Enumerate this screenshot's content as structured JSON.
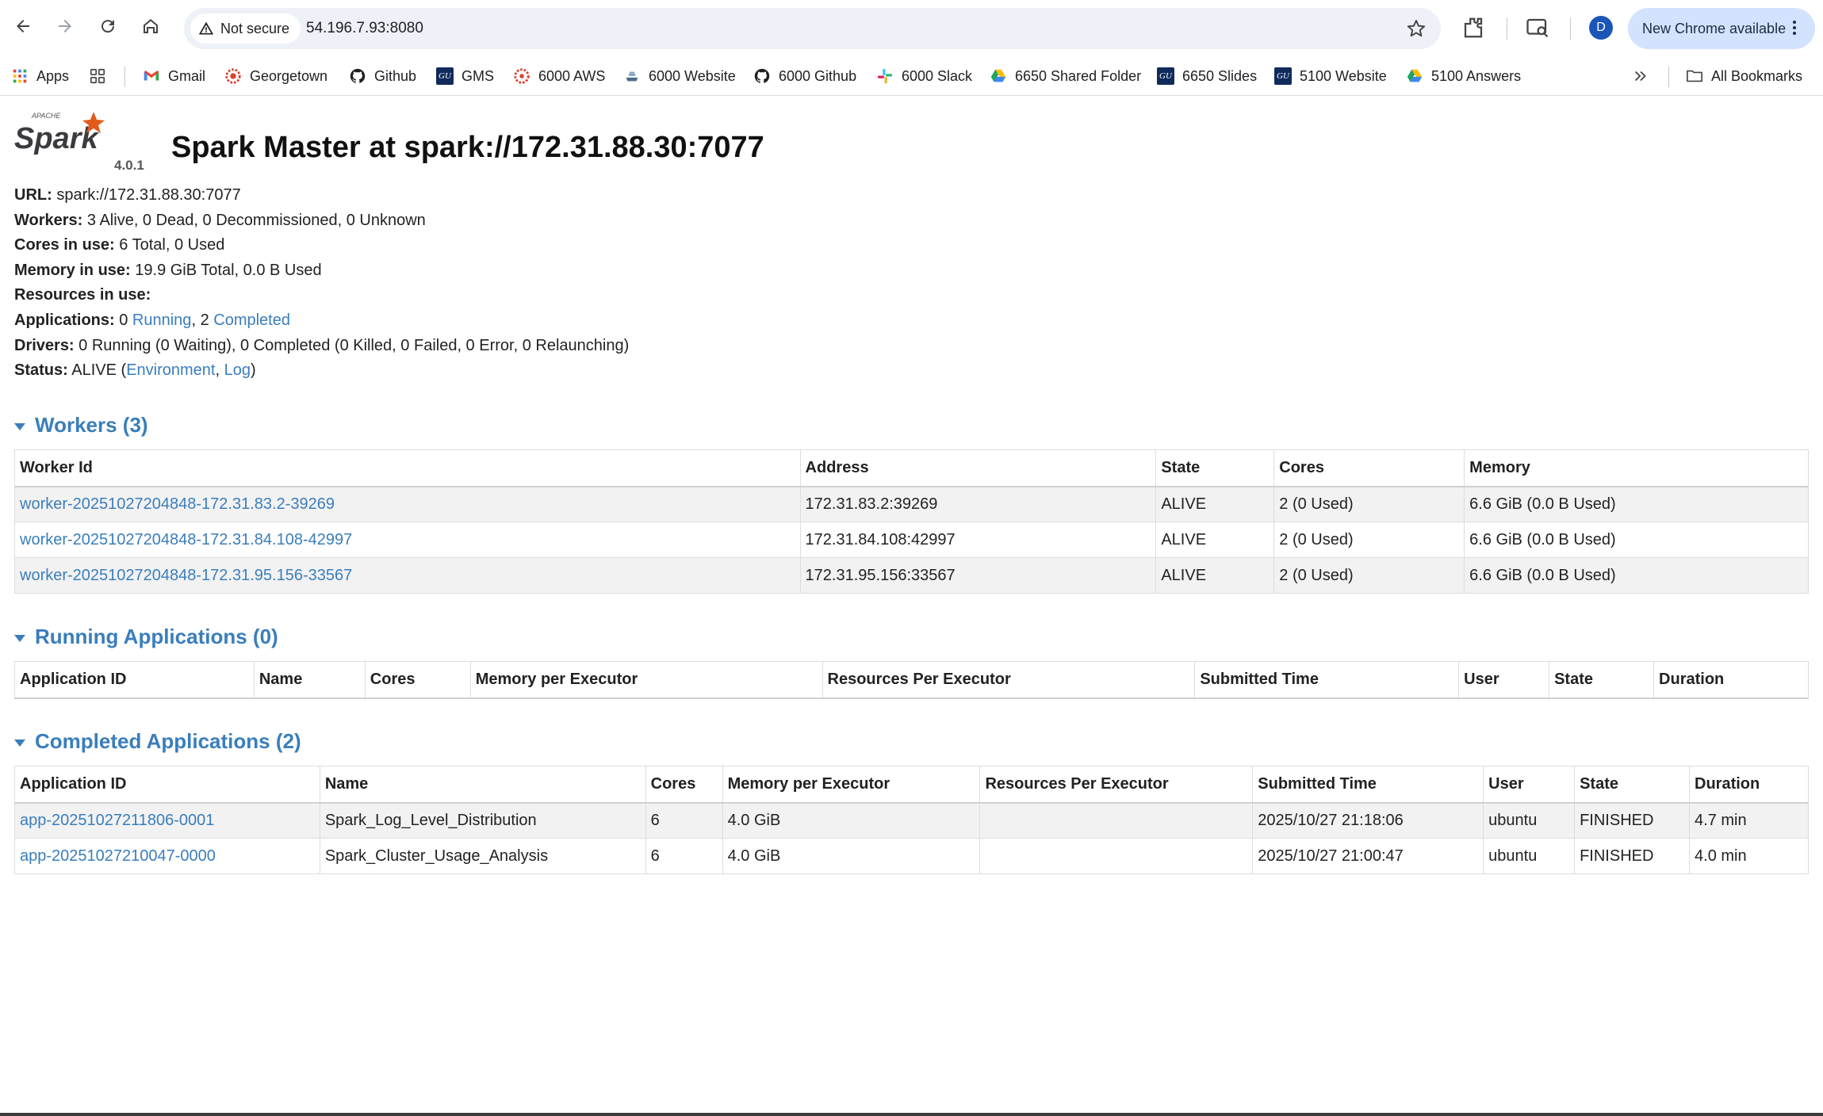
{
  "browser": {
    "security_label": "Not secure",
    "url": "54.196.7.93:8080",
    "update_label": "New Chrome available",
    "profile_initial": "D",
    "bookmarks": [
      {
        "label": "Apps",
        "icon": "apps-grid-icon"
      },
      {
        "label": "Gmail",
        "icon": "gmail-icon"
      },
      {
        "label": "Georgetown",
        "icon": "georgetown-icon"
      },
      {
        "label": "Github",
        "icon": "github-icon"
      },
      {
        "label": "GMS",
        "icon": "gu-icon"
      },
      {
        "label": "6000 AWS",
        "icon": "canvas-icon"
      },
      {
        "label": "6000 Website",
        "icon": "website-icon"
      },
      {
        "label": "6000 Github",
        "icon": "github-icon"
      },
      {
        "label": "6000 Slack",
        "icon": "slack-icon"
      },
      {
        "label": "6650 Shared Folder",
        "icon": "drive-icon"
      },
      {
        "label": "6650 Slides",
        "icon": "gu-icon"
      },
      {
        "label": "5100 Website",
        "icon": "gu-icon"
      },
      {
        "label": "5100 Answers",
        "icon": "drive-icon"
      }
    ],
    "all_bookmarks_label": "All Bookmarks",
    "gu_badge_text": "GU"
  },
  "header": {
    "logo_text": "Spark",
    "logo_small_text": "APACHE",
    "version": "4.0.1",
    "title": "Spark Master at spark://172.31.88.30:7077"
  },
  "summary": {
    "url_label": "URL:",
    "url_value": "spark://172.31.88.30:7077",
    "workers_label": "Workers:",
    "workers_value": "3 Alive, 0 Dead, 0 Decommissioned, 0 Unknown",
    "cores_label": "Cores in use:",
    "cores_value": "6 Total, 0 Used",
    "memory_label": "Memory in use:",
    "memory_value": "19.9 GiB Total, 0.0 B Used",
    "resources_label": "Resources in use:",
    "applications_label": "Applications:",
    "applications_running_count": "0",
    "applications_running_link": "Running",
    "applications_sep": ",",
    "applications_completed_count": "2",
    "applications_completed_link": "Completed",
    "drivers_label": "Drivers:",
    "drivers_value": "0 Running (0 Waiting), 0 Completed (0 Killed, 0 Failed, 0 Error, 0 Relaunching)",
    "status_label": "Status:",
    "status_value": "ALIVE",
    "status_open": "(",
    "status_env_link": "Environment",
    "status_comma": ",",
    "status_log_link": "Log",
    "status_close": ")"
  },
  "workers": {
    "title": "Workers (3)",
    "columns": [
      "Worker Id",
      "Address",
      "State",
      "Cores",
      "Memory"
    ],
    "rows": [
      [
        "worker-20251027204848-172.31.83.2-39269",
        "172.31.83.2:39269",
        "ALIVE",
        "2 (0 Used)",
        "6.6 GiB (0.0 B Used)"
      ],
      [
        "worker-20251027204848-172.31.84.108-42997",
        "172.31.84.108:42997",
        "ALIVE",
        "2 (0 Used)",
        "6.6 GiB (0.0 B Used)"
      ],
      [
        "worker-20251027204848-172.31.95.156-33567",
        "172.31.95.156:33567",
        "ALIVE",
        "2 (0 Used)",
        "6.6 GiB (0.0 B Used)"
      ]
    ]
  },
  "running_apps": {
    "title": "Running Applications (0)",
    "columns": [
      "Application ID",
      "Name",
      "Cores",
      "Memory per Executor",
      "Resources Per Executor",
      "Submitted Time",
      "User",
      "State",
      "Duration"
    ]
  },
  "completed_apps": {
    "title": "Completed Applications (2)",
    "columns": [
      "Application ID",
      "Name",
      "Cores",
      "Memory per Executor",
      "Resources Per Executor",
      "Submitted Time",
      "User",
      "State",
      "Duration"
    ],
    "rows": [
      [
        "app-20251027211806-0001",
        "Spark_Log_Level_Distribution",
        "6",
        "4.0 GiB",
        "",
        "2025/10/27 21:18:06",
        "ubuntu",
        "FINISHED",
        "4.7 min"
      ],
      [
        "app-20251027210047-0000",
        "Spark_Cluster_Usage_Analysis",
        "6",
        "4.0 GiB",
        "",
        "2025/10/27 21:00:47",
        "ubuntu",
        "FINISHED",
        "4.0 min"
      ]
    ]
  },
  "colors": {
    "link": "#3a7ebc",
    "spark_orange": "#e25a1c",
    "update_pill": "#d3e3fd",
    "omnibox": "#eef1f8"
  }
}
